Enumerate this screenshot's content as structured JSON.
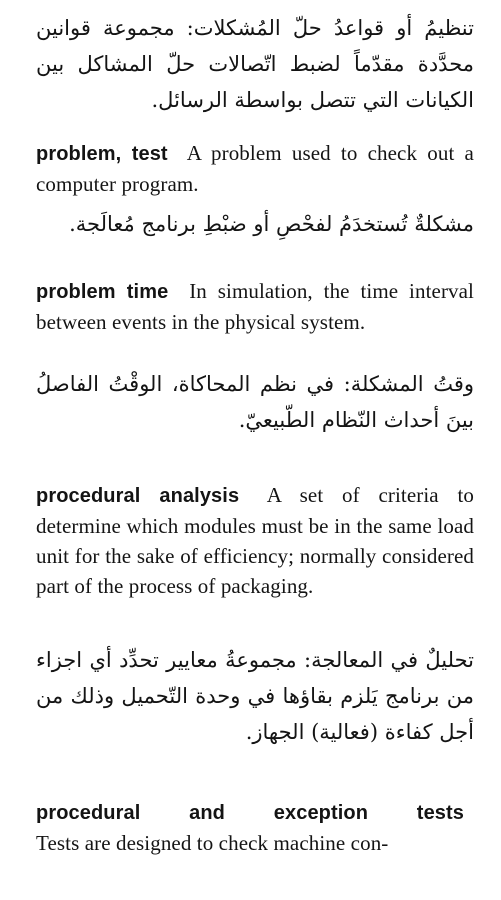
{
  "continuation": {
    "arabic": "تنظيمُ أو قواعدُ حلّ المُشكلات: مجموعة قوانين محدَّدة مقدّماً لضبط اتّصالات حلّ المشاكل بين الكيانات التي تتصل بواسطة الرسائل."
  },
  "entries": [
    {
      "term": "problem, test",
      "definition": "A problem used to check out a computer program.",
      "arabic": "مشكلةٌ تُستخدَمُ لفحْصِ أو ضبْطِ برنامج مُعالَجة."
    },
    {
      "term": "problem time",
      "definition": "In simulation, the time interval between events in the physical system.",
      "arabic": "وقتُ المشكلة: في نظم المحاكاة، الوقْتُ الفاصلُ بينَ أحداث النّظام الطّبيعيّ."
    },
    {
      "term": "procedural analysis",
      "definition": "A set of criteria to determine which modules must be in the same load unit for the sake of efficiency; normally considered part of the process of packaging.",
      "arabic": "تحليلٌ في المعالجة: مجموعةُ معايير تحدِّد أي اجزاء من برنامج يَلزم بقاؤها في وحدة التّحميل وذلك من أجل كفاءة (فعالية) الجهاز."
    },
    {
      "term": "procedural and exception tests",
      "definition": "Tests are designed to check machine con-"
    }
  ]
}
